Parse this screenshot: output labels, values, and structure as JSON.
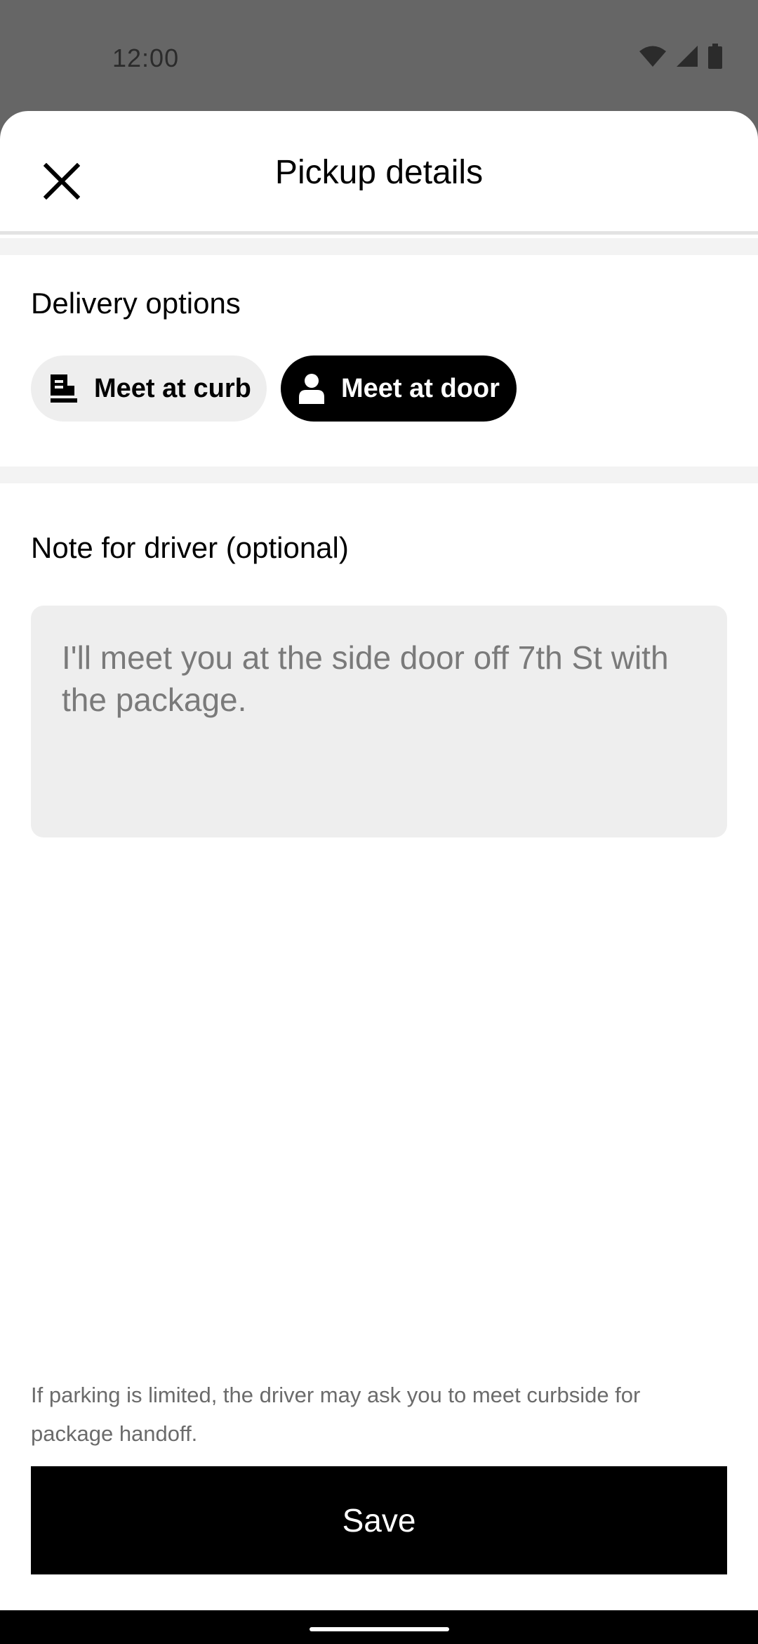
{
  "status_bar": {
    "time": "12:00",
    "icons": [
      "wifi-icon",
      "cellular-signal-icon",
      "battery-icon"
    ]
  },
  "header": {
    "title": "Pickup details",
    "close_icon": "close-icon"
  },
  "delivery_options": {
    "heading": "Delivery options",
    "options": [
      {
        "label": "Meet at curb",
        "icon": "curb-icon",
        "selected": false
      },
      {
        "label": "Meet at door",
        "icon": "person-icon",
        "selected": true
      }
    ]
  },
  "note": {
    "heading": "Note for driver (optional)",
    "placeholder": "I'll meet you at the side door off 7th St with the package.",
    "value": ""
  },
  "footer": {
    "disclaimer": "If parking is limited, the driver may ask you to meet curbside for package handoff.",
    "save_label": "Save"
  },
  "colors": {
    "scrim": "#666666",
    "primary": "#000000",
    "chip_unselected": "#eeeeee",
    "input_background": "#eeeeee",
    "muted_text": "#6b6b6b"
  }
}
